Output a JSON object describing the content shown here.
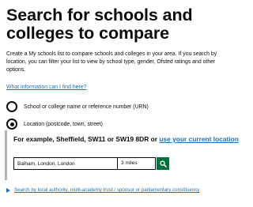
{
  "header": {
    "title": "Search for schools and colleges to compare"
  },
  "intro": {
    "text": "Create a My schools list to compare schools and colleges in your area. If you search by location, you can filter your list to view by school type, gender, Ofsted ratings and other options."
  },
  "help_link": "What information can I find here?",
  "search_options": {
    "name_label": "School or college name or reference number (URN)",
    "location_label": "Location (postcode, town, street)",
    "selected": "location"
  },
  "location_search": {
    "example_text": "For example, Sheffield, SW11 or SW19 8DR or",
    "current_location_link": "use your current location",
    "input_value": "Balham, London, London",
    "distance_value": "3 miles",
    "button_color": "#00703c",
    "button_icon": "search-icon"
  },
  "other_search": {
    "label": "Search by local authority, multi-academy trust / sponsor or parliamentary constituency"
  },
  "colors": {
    "link": "#1d70b8",
    "text": "#0b0c0c",
    "border": "#b1b4b6"
  }
}
